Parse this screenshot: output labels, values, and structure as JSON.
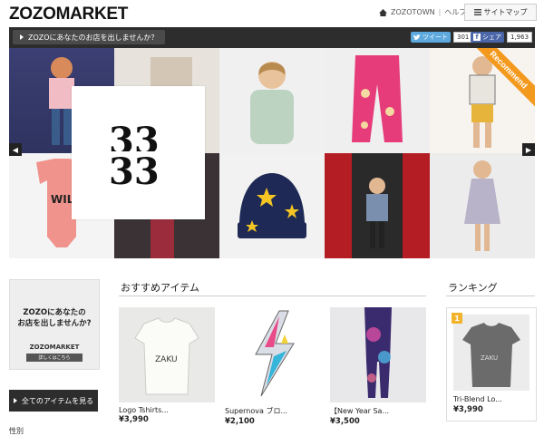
{
  "header": {
    "logo": "ZOZOMARKET",
    "zozotown_link": "ZOZOTOWN",
    "separator": "|",
    "help_link": "ヘルプ",
    "sitemap_label": "サイトマップ"
  },
  "bar": {
    "open_shop_button": "ZOZOにあなたのお店を出しませんか？",
    "tweet_label": "ツイート",
    "tweet_count": "301",
    "share_label": "シェア",
    "share_count": "1,963"
  },
  "hero": {
    "logo_text": "33",
    "ribbon": "Recommend",
    "prev_arrow": "◀",
    "next_arrow": "▶"
  },
  "banner": {
    "line1": "ZOZOにあなたの",
    "line2": "お店を出しませんか?",
    "logo": "ZOZOMARKET",
    "button": "詳しくはこちら"
  },
  "sidebar": {
    "all_items_button": "全てのアイテムを見る",
    "cut_label": "性別"
  },
  "recommend": {
    "title": "おすすめアイテム",
    "items": [
      {
        "name": "Logo Tshirts...",
        "price": "¥3,990"
      },
      {
        "name": "Supernova ブロ...",
        "price": "¥2,100"
      },
      {
        "name": "【New Year Sa...",
        "price": "¥3,500"
      }
    ]
  },
  "ranking": {
    "title": "ランキング",
    "items": [
      {
        "rank": "1",
        "name": "Tri-Blend Lo...",
        "price": "¥3,990"
      }
    ]
  }
}
